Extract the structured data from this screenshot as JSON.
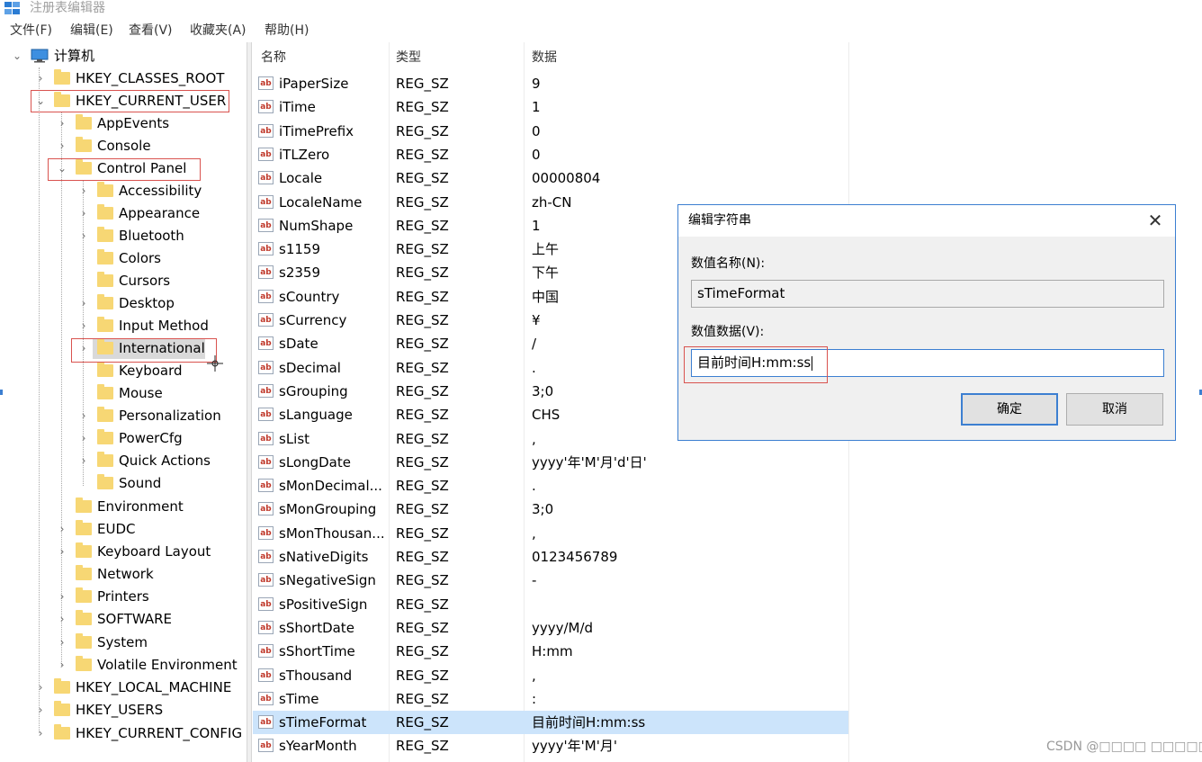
{
  "window": {
    "title": "注册表编辑器"
  },
  "menu": [
    "文件(F)",
    "编辑(E)",
    "查看(V)",
    "收藏夹(A)",
    "帮助(H)"
  ],
  "tree": {
    "root": "计算机",
    "hives": {
      "classes_root": "HKEY_CLASSES_ROOT",
      "current_user": "HKEY_CURRENT_USER",
      "local_machine": "HKEY_LOCAL_MACHINE",
      "users": "HKEY_USERS",
      "current_config": "HKEY_CURRENT_CONFIG"
    },
    "hkcu_children": [
      "AppEvents",
      "Console",
      "Control Panel",
      "Environment",
      "EUDC",
      "Keyboard Layout",
      "Network",
      "Printers",
      "SOFTWARE",
      "System",
      "Volatile Environment"
    ],
    "control_panel_children": [
      "Accessibility",
      "Appearance",
      "Bluetooth",
      "Colors",
      "Cursors",
      "Desktop",
      "Input Method",
      "International",
      "Keyboard",
      "Mouse",
      "Personalization",
      "PowerCfg",
      "Quick Actions",
      "Sound"
    ],
    "selected": "International"
  },
  "list": {
    "headers": {
      "name": "名称",
      "type": "类型",
      "data": "数据"
    },
    "value_icon_text": "ab",
    "rows": [
      {
        "name": "iPaperSize",
        "type": "REG_SZ",
        "data": "9"
      },
      {
        "name": "iTime",
        "type": "REG_SZ",
        "data": "1"
      },
      {
        "name": "iTimePrefix",
        "type": "REG_SZ",
        "data": "0"
      },
      {
        "name": "iTLZero",
        "type": "REG_SZ",
        "data": "0"
      },
      {
        "name": "Locale",
        "type": "REG_SZ",
        "data": "00000804"
      },
      {
        "name": "LocaleName",
        "type": "REG_SZ",
        "data": "zh-CN"
      },
      {
        "name": "NumShape",
        "type": "REG_SZ",
        "data": "1"
      },
      {
        "name": "s1159",
        "type": "REG_SZ",
        "data": "上午"
      },
      {
        "name": "s2359",
        "type": "REG_SZ",
        "data": "下午"
      },
      {
        "name": "sCountry",
        "type": "REG_SZ",
        "data": "中国"
      },
      {
        "name": "sCurrency",
        "type": "REG_SZ",
        "data": "¥"
      },
      {
        "name": "sDate",
        "type": "REG_SZ",
        "data": "/"
      },
      {
        "name": "sDecimal",
        "type": "REG_SZ",
        "data": "."
      },
      {
        "name": "sGrouping",
        "type": "REG_SZ",
        "data": "3;0"
      },
      {
        "name": "sLanguage",
        "type": "REG_SZ",
        "data": "CHS"
      },
      {
        "name": "sList",
        "type": "REG_SZ",
        "data": ","
      },
      {
        "name": "sLongDate",
        "type": "REG_SZ",
        "data": "yyyy'年'M'月'd'日'"
      },
      {
        "name": "sMonDecimal...",
        "type": "REG_SZ",
        "data": "."
      },
      {
        "name": "sMonGrouping",
        "type": "REG_SZ",
        "data": "3;0"
      },
      {
        "name": "sMonThousan...",
        "type": "REG_SZ",
        "data": ","
      },
      {
        "name": "sNativeDigits",
        "type": "REG_SZ",
        "data": "0123456789"
      },
      {
        "name": "sNegativeSign",
        "type": "REG_SZ",
        "data": "-"
      },
      {
        "name": "sPositiveSign",
        "type": "REG_SZ",
        "data": ""
      },
      {
        "name": "sShortDate",
        "type": "REG_SZ",
        "data": "yyyy/M/d"
      },
      {
        "name": "sShortTime",
        "type": "REG_SZ",
        "data": "H:mm"
      },
      {
        "name": "sThousand",
        "type": "REG_SZ",
        "data": ","
      },
      {
        "name": "sTime",
        "type": "REG_SZ",
        "data": ":"
      },
      {
        "name": "sTimeFormat",
        "type": "REG_SZ",
        "data": "目前时间H:mm:ss",
        "selected": true
      },
      {
        "name": "sYearMonth",
        "type": "REG_SZ",
        "data": "yyyy'年'M'月'"
      }
    ]
  },
  "dialog": {
    "title": "编辑字符串",
    "close_glyph": "✕",
    "name_label": "数值名称(N):",
    "name_value": "sTimeFormat",
    "data_label": "数值数据(V):",
    "data_value": "目前时间H:mm:ss",
    "ok": "确定",
    "cancel": "取消"
  },
  "watermark": "CSDN @□□□□ □□□□□ □□",
  "colors": {
    "accent": "#3c7fd1",
    "folder": "#f7d774",
    "annotation_red": "#d9534f",
    "selection": "#cce4fb"
  }
}
